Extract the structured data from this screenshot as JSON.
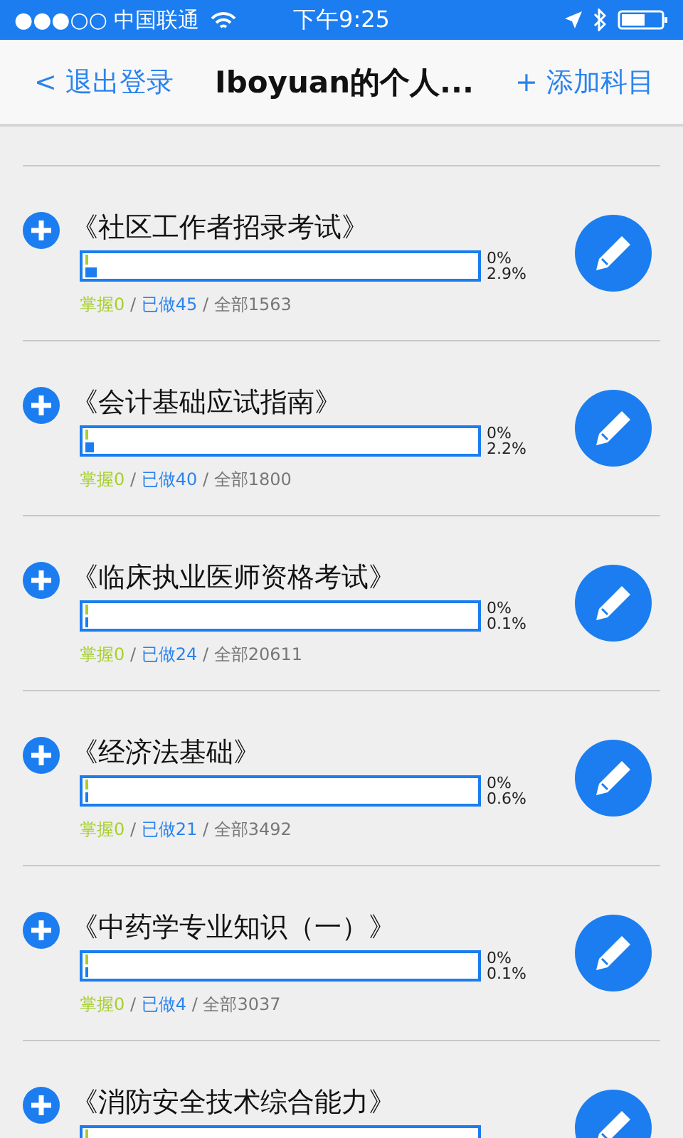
{
  "status_bar": {
    "carrier": "●●●○○ 中国联通",
    "time": "下午9:25"
  },
  "nav": {
    "back": "< 退出登录",
    "title": "Iboyuan的个人...",
    "add": "+ 添加科目"
  },
  "subjects": [
    {
      "title": "《社区工作者招录考试》",
      "mastered_bar": {
        "level": 0
      },
      "done_bar": {
        "level": 0.029
      },
      "mastered_pct": "0%",
      "done_pct": "2.9%",
      "mastered": "掌握0",
      "sep_1": "/",
      "done": "已做45",
      "sep_2": "/",
      "total": "全部1563"
    },
    {
      "title": "《会计基础应试指南》",
      "mastered_bar": {
        "level": 0
      },
      "done_bar": {
        "level": 0.022
      },
      "mastered_pct": "0%",
      "done_pct": "2.2%",
      "mastered": "掌握0",
      "sep_1": "/",
      "done": "已做40",
      "sep_2": "/",
      "total": "全部1800"
    },
    {
      "title": "《临床执业医师资格考试》",
      "mastered_bar": {
        "level": 0
      },
      "done_bar": {
        "level": 0.001
      },
      "mastered_pct": "0%",
      "done_pct": "0.1%",
      "mastered": "掌握0",
      "sep_1": "/",
      "done": "已做24",
      "sep_2": "/",
      "total": "全部20611"
    },
    {
      "title": "《经济法基础》",
      "mastered_bar": {
        "level": 0
      },
      "done_bar": {
        "level": 0.006
      },
      "mastered_pct": "0%",
      "done_pct": "0.6%",
      "mastered": "掌握0",
      "sep_1": "/",
      "done": "已做21",
      "sep_2": "/",
      "total": "全部3492"
    },
    {
      "title": "《中药学专业知识（一）》",
      "mastered_bar": {
        "level": 0
      },
      "done_bar": {
        "level": 0.001
      },
      "mastered_pct": "0%",
      "done_pct": "0.1%",
      "mastered": "掌握0",
      "sep_1": "/",
      "done": "已做4",
      "sep_2": "/",
      "total": "全部3037"
    },
    {
      "title": "《消防安全技术综合能力》",
      "mastered_bar": {
        "level": 0
      }
    }
  ]
}
